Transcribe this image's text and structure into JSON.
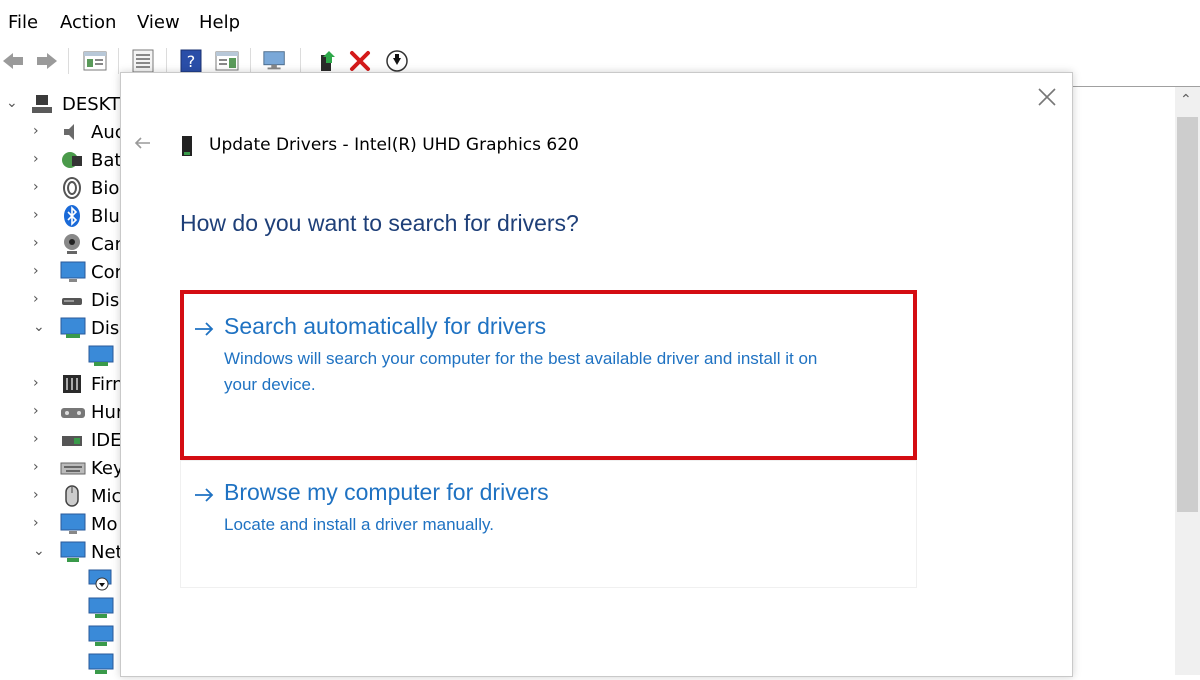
{
  "menu": {
    "items": [
      {
        "label": "File"
      },
      {
        "label": "Action"
      },
      {
        "label": "View"
      },
      {
        "label": "Help"
      }
    ]
  },
  "toolbar": {
    "buttons": [
      "back-arrow-icon",
      "forward-arrow-icon",
      "properties-icon",
      "list-view-icon",
      "help-icon",
      "action-pane-icon",
      "scan-hardware-icon",
      "update-driver-icon",
      "uninstall-x-icon",
      "download-circle-icon"
    ]
  },
  "tree": {
    "root": "DESKTO",
    "items": [
      {
        "label": "Auc",
        "icon": "speaker-icon"
      },
      {
        "label": "Batt",
        "icon": "battery-icon"
      },
      {
        "label": "Bior",
        "icon": "fingerprint-icon"
      },
      {
        "label": "Blue",
        "icon": "bluetooth-icon"
      },
      {
        "label": "Can",
        "icon": "camera-icon"
      },
      {
        "label": "Con",
        "icon": "monitor-icon"
      },
      {
        "label": "Disk",
        "icon": "disk-drive-icon"
      },
      {
        "label": "Disp",
        "icon": "display-adapter-icon"
      },
      {
        "label": "Firn",
        "icon": "firmware-icon"
      },
      {
        "label": "Hun",
        "icon": "hid-icon"
      },
      {
        "label": "IDE",
        "icon": "ide-controller-icon"
      },
      {
        "label": "Key",
        "icon": "keyboard-icon"
      },
      {
        "label": "Mic",
        "icon": "mouse-icon"
      },
      {
        "label": "Mo",
        "icon": "monitor-icon"
      },
      {
        "label": "Net",
        "icon": "network-adapter-icon"
      }
    ]
  },
  "dialog": {
    "title": "Update Drivers - Intel(R) UHD Graphics 620",
    "heading": "How do you want to search for drivers?",
    "options": [
      {
        "title": "Search automatically for drivers",
        "desc_line1": "Windows will search your computer for the best available driver and install it on",
        "desc_line2": "your device."
      },
      {
        "title": "Browse my computer for drivers",
        "desc_line1": "Locate and install a driver manually."
      }
    ],
    "colors": {
      "highlight_border": "#d40d12",
      "option_text": "#1f72c2",
      "heading_text": "#1e3f78"
    }
  }
}
